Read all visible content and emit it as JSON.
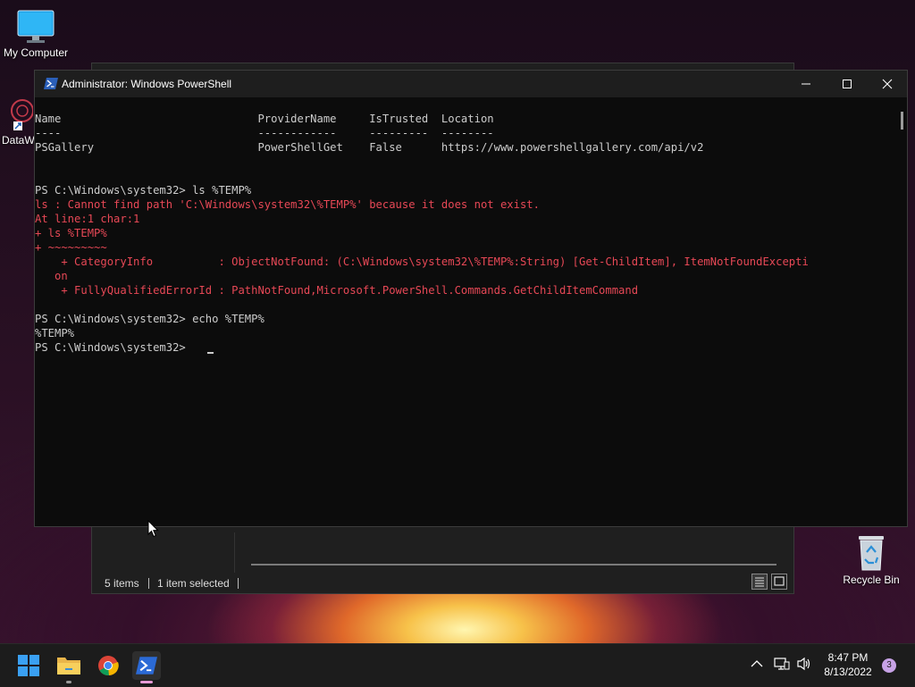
{
  "desktop": {
    "icons": [
      {
        "label": "My Computer",
        "icon": "monitor-icon"
      },
      {
        "label": "DataW",
        "icon": "app-shortcut-icon"
      },
      {
        "label": "Recycle Bin",
        "icon": "recycle-bin-icon"
      }
    ]
  },
  "explorer": {
    "status_items": "5 items",
    "status_selected": "1 item selected",
    "view_buttons": [
      "details-view-icon",
      "large-icons-view-icon"
    ]
  },
  "powershell": {
    "title": "Administrator: Windows PowerShell",
    "controls": [
      "minimize-icon",
      "maximize-icon",
      "close-icon"
    ],
    "lines": [
      {
        "text": "Name                              ProviderName     IsTrusted  Location",
        "type": "normal"
      },
      {
        "text": "----                              ------------     ---------  --------",
        "type": "normal"
      },
      {
        "text": "PSGallery                         PowerShellGet    False      https://www.powershellgallery.com/api/v2",
        "type": "normal"
      },
      {
        "text": "",
        "type": "normal"
      },
      {
        "text": "",
        "type": "normal"
      },
      {
        "text": "PS C:\\Windows\\system32> ls %TEMP%",
        "type": "normal"
      },
      {
        "text": "ls : Cannot find path 'C:\\Windows\\system32\\%TEMP%' because it does not exist.",
        "type": "err"
      },
      {
        "text": "At line:1 char:1",
        "type": "err"
      },
      {
        "text": "+ ls %TEMP%",
        "type": "err"
      },
      {
        "text": "+ ~~~~~~~~~",
        "type": "err"
      },
      {
        "text": "    + CategoryInfo          : ObjectNotFound: (C:\\Windows\\system32\\%TEMP%:String) [Get-ChildItem], ItemNotFoundExcepti",
        "type": "err"
      },
      {
        "text": "   on",
        "type": "err"
      },
      {
        "text": "    + FullyQualifiedErrorId : PathNotFound,Microsoft.PowerShell.Commands.GetChildItemCommand",
        "type": "err"
      },
      {
        "text": "",
        "type": "normal"
      },
      {
        "text": "PS C:\\Windows\\system32> echo %TEMP%",
        "type": "normal"
      },
      {
        "text": "%TEMP%",
        "type": "normal"
      },
      {
        "text": "PS C:\\Windows\\system32> ",
        "type": "normal"
      }
    ]
  },
  "taskbar": {
    "apps": [
      "windows-start-icon",
      "file-explorer-icon",
      "chrome-icon",
      "powershell-icon"
    ],
    "tray_icons": [
      "chevron-up-icon",
      "network-icon",
      "volume-icon"
    ],
    "time": "8:47 PM",
    "date": "8/13/2022",
    "notification_count": "3"
  }
}
